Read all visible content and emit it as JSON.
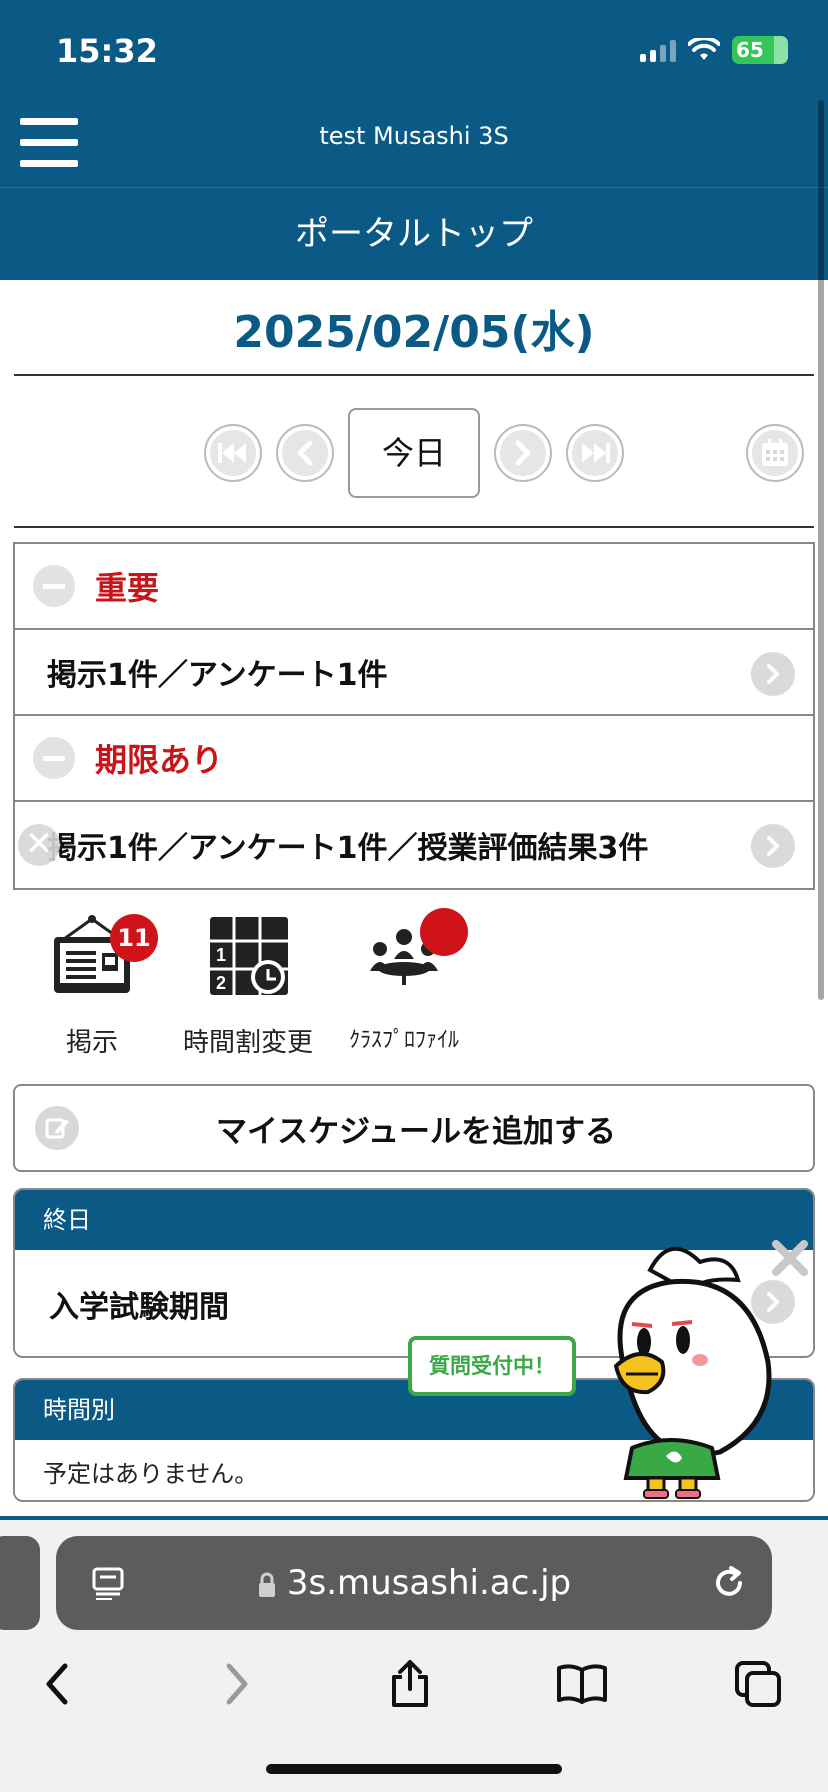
{
  "status_bar": {
    "time": "15:32",
    "battery": "65"
  },
  "header": {
    "app_title": "test Musashi 3S",
    "page_title": "ポータルトップ"
  },
  "date": "2025/02/05(水)",
  "nav": {
    "today_label": "今日"
  },
  "important": {
    "heading": "重要",
    "item": "掲示1件／アンケート1件"
  },
  "deadline": {
    "heading": "期限あり",
    "item": "掲示1件／アンケート1件／授業評価結果3件"
  },
  "quick_links": [
    {
      "label": "掲示",
      "badge": "11",
      "icon": "bulletin-board-icon"
    },
    {
      "label": "時間割変更",
      "icon": "timetable-change-icon"
    },
    {
      "label": "ｸﾗｽﾌﾟﾛﾌｧｲﾙ",
      "icon": "class-profile-icon"
    }
  ],
  "add_schedule": {
    "label": "マイスケジュールを追加する"
  },
  "allday": {
    "header": "終日",
    "item": "入学試験期間"
  },
  "timed": {
    "header": "時間別",
    "empty_text": "予定はありません。"
  },
  "mascot": {
    "bubble": "質問受付中！"
  },
  "browser": {
    "url": "3s.musashi.ac.jp"
  },
  "colors": {
    "brand_blue": "#0b5a86",
    "alert_red": "#c9141a",
    "badge_red": "#d0121b",
    "mascot_green": "#3aa845"
  }
}
